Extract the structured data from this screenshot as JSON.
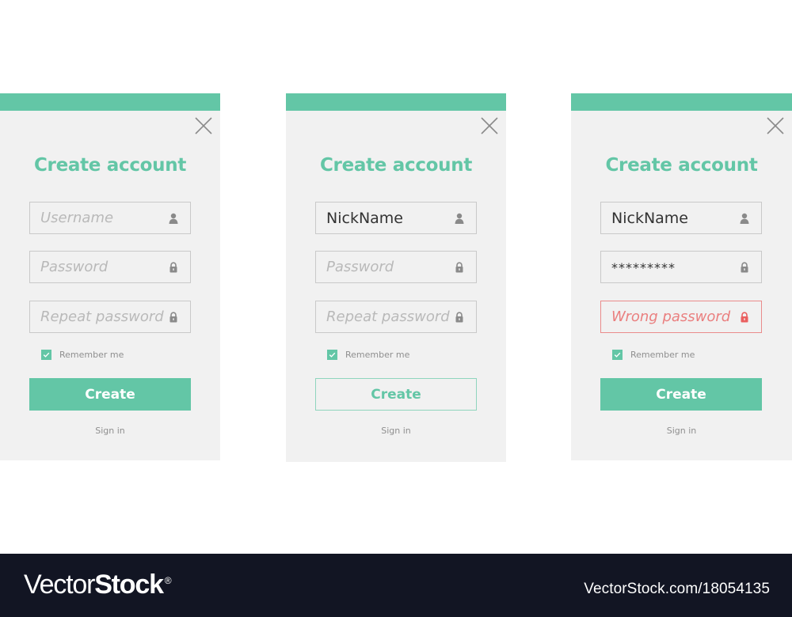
{
  "colors": {
    "accent": "#63c6a6",
    "error": "#ea7f7f",
    "card_bg": "#f1f1f1",
    "footer_bg": "#121523"
  },
  "cards": [
    {
      "title": "Create account",
      "fields": [
        {
          "value": "",
          "placeholder": "Username",
          "icon": "user-icon"
        },
        {
          "value": "",
          "placeholder": "Password",
          "icon": "lock-icon"
        },
        {
          "value": "",
          "placeholder": "Repeat password",
          "icon": "lock-icon"
        }
      ],
      "remember_label": "Remember me",
      "remember_checked": true,
      "create_label": "Create",
      "signin_label": "Sign in"
    },
    {
      "title": "Create account",
      "fields": [
        {
          "value": "NickName",
          "placeholder": "",
          "icon": "user-icon"
        },
        {
          "value": "",
          "placeholder": "Password",
          "icon": "lock-icon"
        },
        {
          "value": "",
          "placeholder": "Repeat password",
          "icon": "lock-icon"
        }
      ],
      "remember_label": "Remember me",
      "remember_checked": true,
      "create_label": "Create",
      "signin_label": "Sign in"
    },
    {
      "title": "Create account",
      "fields": [
        {
          "value": "NickName",
          "placeholder": "",
          "icon": "user-icon"
        },
        {
          "value": "*********",
          "placeholder": "",
          "icon": "lock-icon"
        },
        {
          "value": "",
          "placeholder": "Wrong password",
          "icon": "lock-icon"
        }
      ],
      "remember_label": "Remember me",
      "remember_checked": true,
      "create_label": "Create",
      "signin_label": "Sign in"
    }
  ],
  "footer": {
    "brand_light": "Vector",
    "brand_bold": "Stock",
    "brand_reg": "®",
    "image_id": "VectorStock.com/18054135"
  }
}
